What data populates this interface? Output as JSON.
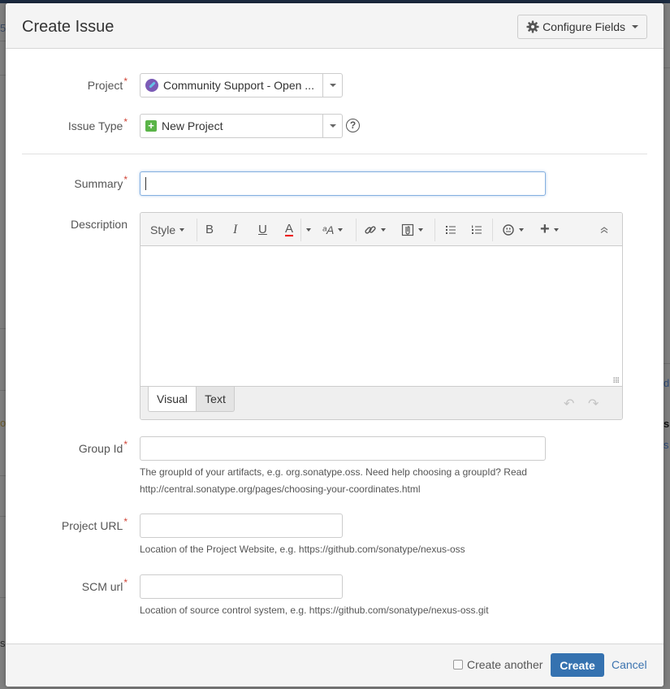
{
  "dialog": {
    "title": "Create Issue",
    "configure_fields_label": "Configure Fields"
  },
  "fields": {
    "project": {
      "label": "Project",
      "required": true,
      "value": "Community Support - Open ..."
    },
    "issue_type": {
      "label": "Issue Type",
      "required": true,
      "value": "New Project"
    },
    "summary": {
      "label": "Summary",
      "required": true,
      "value": ""
    },
    "description": {
      "label": "Description",
      "toolbar": {
        "style_label": "Style",
        "bold": "B",
        "italic": "I",
        "underline": "U",
        "text_color": "A",
        "text_effects": "ᵃA"
      },
      "tabs": [
        "Visual",
        "Text"
      ],
      "active_tab": "Visual"
    },
    "group_id": {
      "label": "Group Id",
      "required": true,
      "value": "",
      "help_line1": "The groupId of your artifacts, e.g. org.sonatype.oss. Need help choosing a groupId? Read",
      "help_line2": "http://central.sonatype.org/pages/choosing-your-coordinates.html"
    },
    "project_url": {
      "label": "Project URL",
      "required": true,
      "value": "",
      "help": "Location of the Project Website, e.g. https://github.com/sonatype/nexus-oss"
    },
    "scm_url": {
      "label": "SCM url",
      "required": true,
      "value": "",
      "help": "Location of source control system, e.g. https://github.com/sonatype/nexus-oss.git"
    }
  },
  "required_marker": "*",
  "footer": {
    "create_another_label": "Create another",
    "create_another_checked": false,
    "create_label": "Create",
    "cancel_label": "Cancel"
  },
  "colors": {
    "primary_button": "#3572b0",
    "link": "#3b73af",
    "required": "#d04437",
    "issue_type_icon": "#5ab448",
    "project_avatar": "#7b5bb6"
  },
  "background_fragments": [
    "5",
    "d",
    "s",
    "s",
    "o",
    "sc"
  ]
}
